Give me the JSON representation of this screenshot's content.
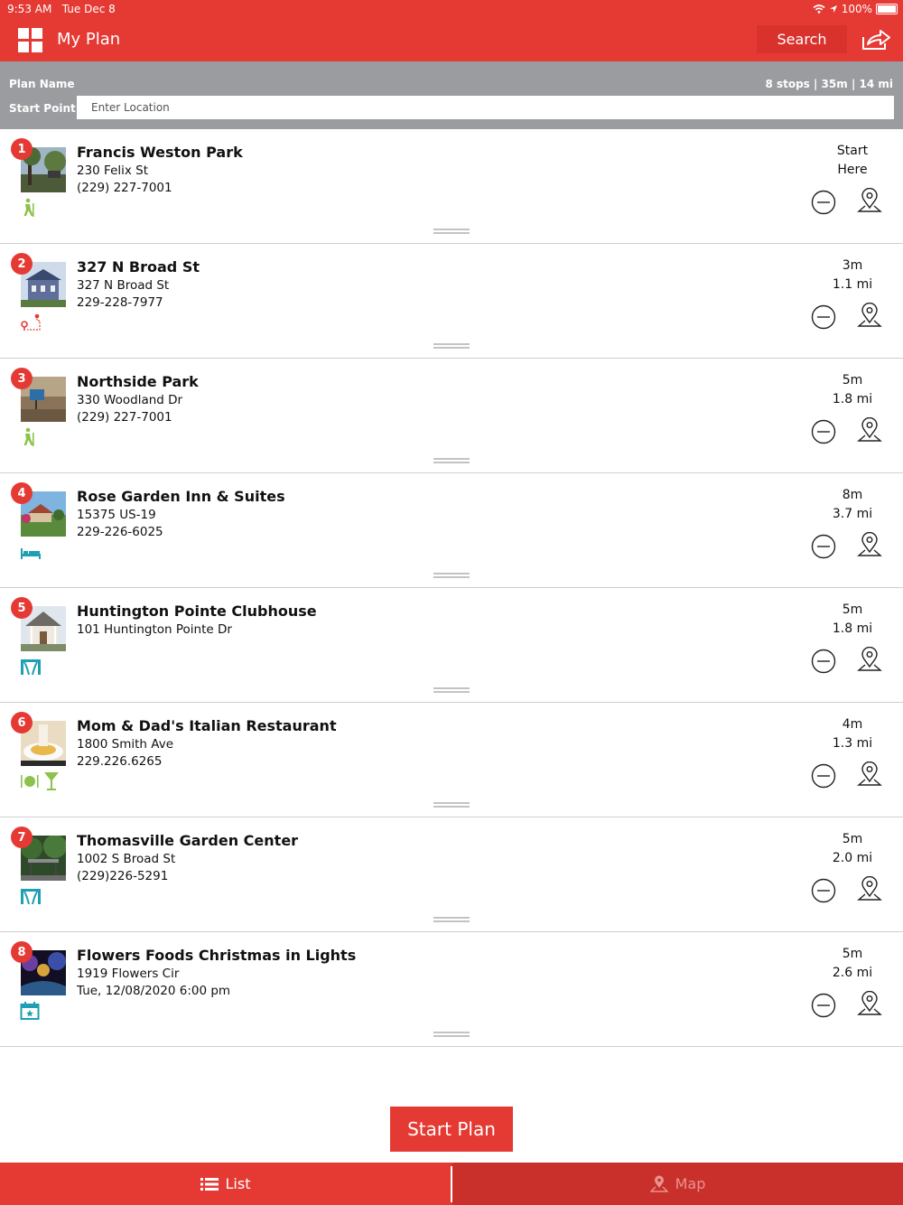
{
  "status_bar": {
    "time": "9:53 AM",
    "date": "Tue Dec 8",
    "battery": "100%"
  },
  "header": {
    "title": "My Plan",
    "search_label": "Search"
  },
  "plan": {
    "name_label": "Plan Name",
    "summary": "8 stops | 35m | 14 mi",
    "start_label": "Start Point",
    "location_placeholder": "Enter Location"
  },
  "stops": [
    {
      "num": "1",
      "name": "Francis Weston Park",
      "address": "230 Felix St",
      "detail": "(229) 227-7001",
      "time": "Start",
      "distance": "Here",
      "category": "hiking-icon"
    },
    {
      "num": "2",
      "name": "327 N Broad St",
      "address": "327 N Broad St",
      "detail": "229-228-7977",
      "time": "3m",
      "distance": "1.1 mi",
      "category": "route-icon"
    },
    {
      "num": "3",
      "name": "Northside Park",
      "address": "330 Woodland Dr",
      "detail": "(229) 227-7001",
      "time": "5m",
      "distance": "1.8 mi",
      "category": "hiking-icon"
    },
    {
      "num": "4",
      "name": "Rose Garden Inn & Suites",
      "address": "15375 US-19",
      "detail": "229-226-6025",
      "time": "8m",
      "distance": "3.7 mi",
      "category": "bed-icon"
    },
    {
      "num": "5",
      "name": "Huntington Pointe Clubhouse",
      "address": "101 Huntington Pointe Dr",
      "detail": "",
      "time": "5m",
      "distance": "1.8 mi",
      "category": "venue-icon"
    },
    {
      "num": "6",
      "name": "Mom & Dad's Italian Restaurant",
      "address": "1800 Smith Ave",
      "detail": "229.226.6265",
      "time": "4m",
      "distance": "1.3 mi",
      "category": "dining-icon"
    },
    {
      "num": "7",
      "name": "Thomasville Garden Center",
      "address": "1002 S Broad St",
      "detail": "(229)226-5291",
      "time": "5m",
      "distance": "2.0 mi",
      "category": "venue-icon"
    },
    {
      "num": "8",
      "name": "Flowers Foods Christmas in Lights",
      "address": "1919 Flowers Cir",
      "detail": "Tue, 12/08/2020 6:00 pm",
      "time": "5m",
      "distance": "2.6 mi",
      "category": "calendar-icon"
    }
  ],
  "start_plan_label": "Start Plan",
  "tabs": {
    "list": "List",
    "map": "Map"
  },
  "colors": {
    "brand": "#e53a34",
    "plan_bar": "#9a9c9f",
    "activity": "#8bc34a",
    "lodging": "#1e9fb3"
  }
}
